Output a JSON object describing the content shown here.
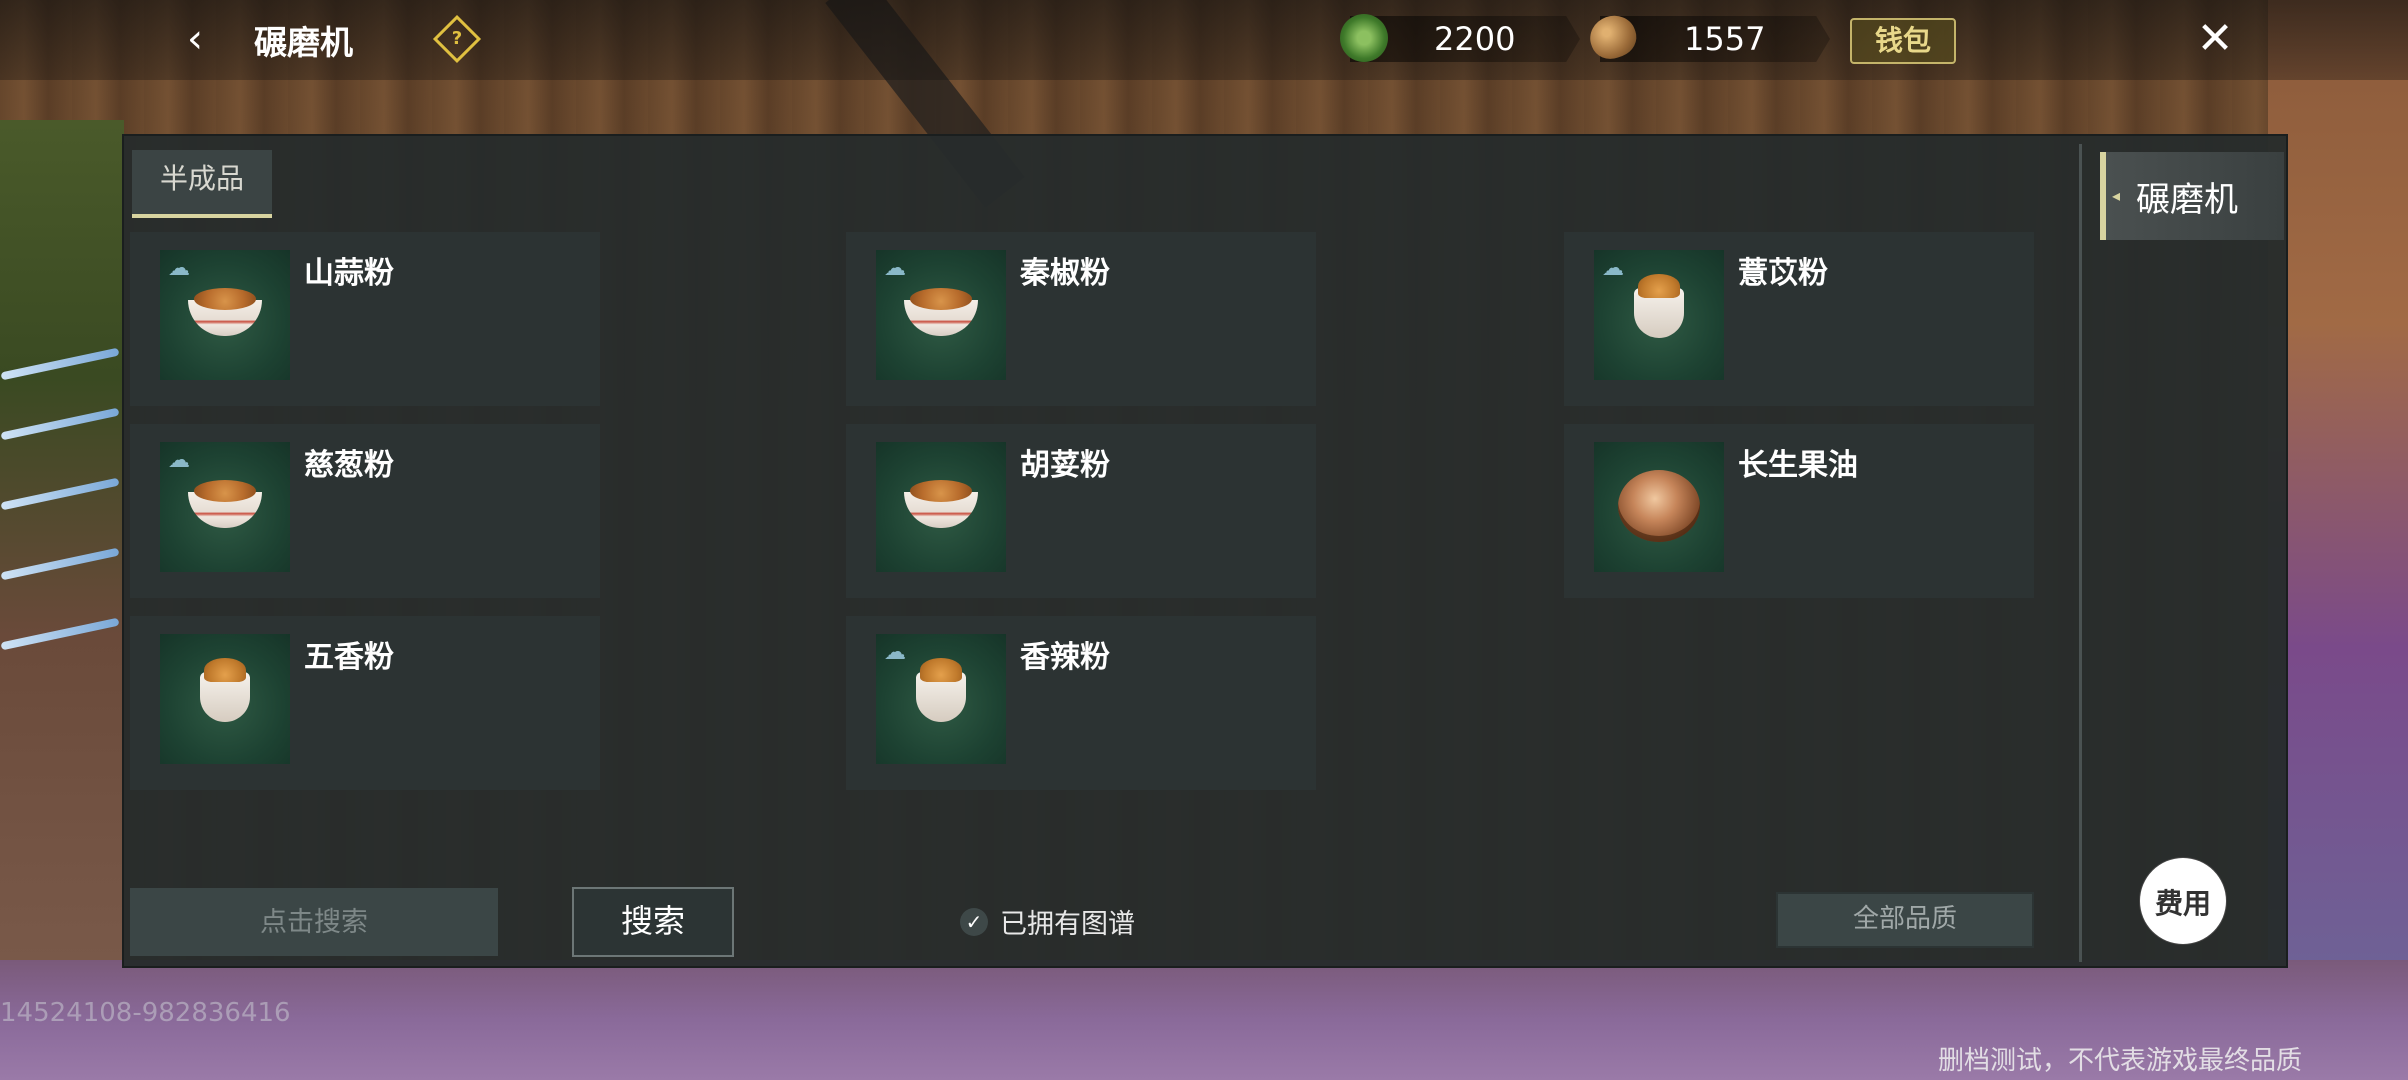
{
  "header": {
    "back_icon": "chevron-left-icon",
    "title": "碾磨机",
    "help_icon": "diamond-help-icon",
    "currencies": [
      {
        "icon": "green-coin-icon",
        "value": "2200"
      },
      {
        "icon": "seed-icon",
        "value": "1557"
      }
    ],
    "wallet_label": "钱包",
    "close_icon": "crossed-swords-close-icon"
  },
  "tabs": [
    {
      "label": "半成品",
      "active": true
    }
  ],
  "items": [
    {
      "name": "山蒜粉",
      "icon": "bowl-powder",
      "rain": true
    },
    {
      "name": "秦椒粉",
      "icon": "bowl-powder",
      "rain": true
    },
    {
      "name": "薏苡粉",
      "icon": "cup-powder",
      "rain": true
    },
    {
      "name": "慈葱粉",
      "icon": "bowl-powder",
      "rain": true
    },
    {
      "name": "胡荽粉",
      "icon": "bowl-powder",
      "rain": false
    },
    {
      "name": "长生果油",
      "icon": "oil-bowl",
      "rain": false
    },
    {
      "name": "五香粉",
      "icon": "cup-powder",
      "rain": false
    },
    {
      "name": "香辣粉",
      "icon": "cup-powder",
      "rain": true
    }
  ],
  "bottom": {
    "search_placeholder": "点击搜索",
    "search_button": "搜索",
    "owned_label": "已拥有图谱",
    "owned_checked": true,
    "quality_select": "全部品质"
  },
  "side": {
    "tab_label": "碾磨机",
    "cost_label": "费用"
  },
  "footer": {
    "uid": "14524108-982836416",
    "disclaimer": "删档测试，不代表游戏最终品质"
  },
  "colors": {
    "panel": "#262c2c",
    "card": "#2c3333",
    "accent": "#d8d4a0",
    "wallet": "#e8d88a"
  }
}
